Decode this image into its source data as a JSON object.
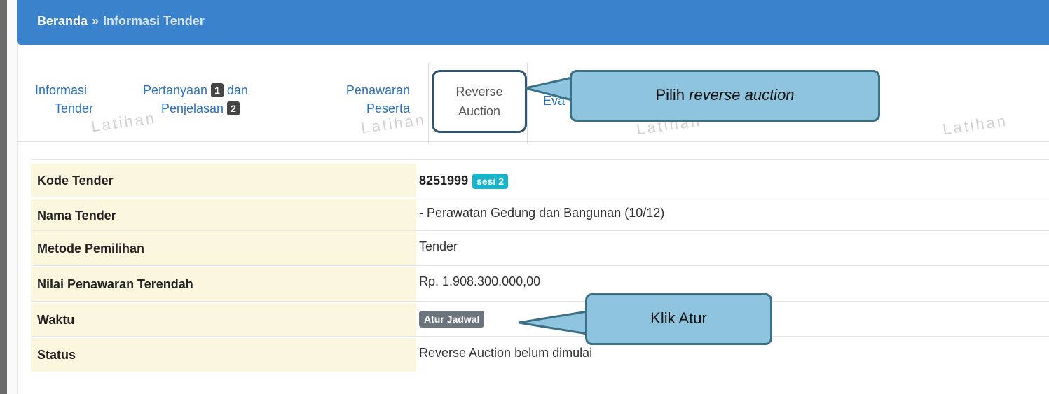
{
  "breadcrumb": {
    "home": "Beranda",
    "separator": "»",
    "current": "Informasi Tender"
  },
  "tabs": [
    {
      "line1": "Informasi",
      "line2": "Tender"
    },
    {
      "line1": "Pertanyaan",
      "badge1": "1",
      "line1b": "dan",
      "line2": "Penjelasan",
      "badge2": "2"
    },
    {
      "line1": "Penawaran",
      "line2": "Peserta"
    },
    {
      "line1": "Reverse",
      "line2": "Auction"
    },
    {
      "line1": "Eva"
    }
  ],
  "watermark": "Latihan",
  "callouts": {
    "reverse": {
      "prefix": "Pilih ",
      "emph": "reverse auction"
    },
    "atur": "Klik Atur"
  },
  "table": {
    "rows": [
      {
        "key": "Kode Tender",
        "value": "8251999",
        "badge": "sesi 2"
      },
      {
        "key": "Nama Tender",
        "value": "- Perawatan Gedung dan Bangunan (10/12)"
      },
      {
        "key": "Metode Pemilihan",
        "value": "Tender"
      },
      {
        "key": "Nilai Penawaran Terendah",
        "value": "Rp. 1.908.300.000,00"
      },
      {
        "key": "Waktu",
        "button": "Atur Jadwal"
      },
      {
        "key": "Status",
        "value": "Reverse Auction belum dimulai"
      }
    ]
  },
  "colors": {
    "header": "#3b82cc",
    "link": "#2a73c4",
    "callout_fill": "#8ec4dd",
    "callout_border": "#3a6f86",
    "key_cell": "#fbf6de",
    "sesi_badge": "#18b4c9"
  }
}
